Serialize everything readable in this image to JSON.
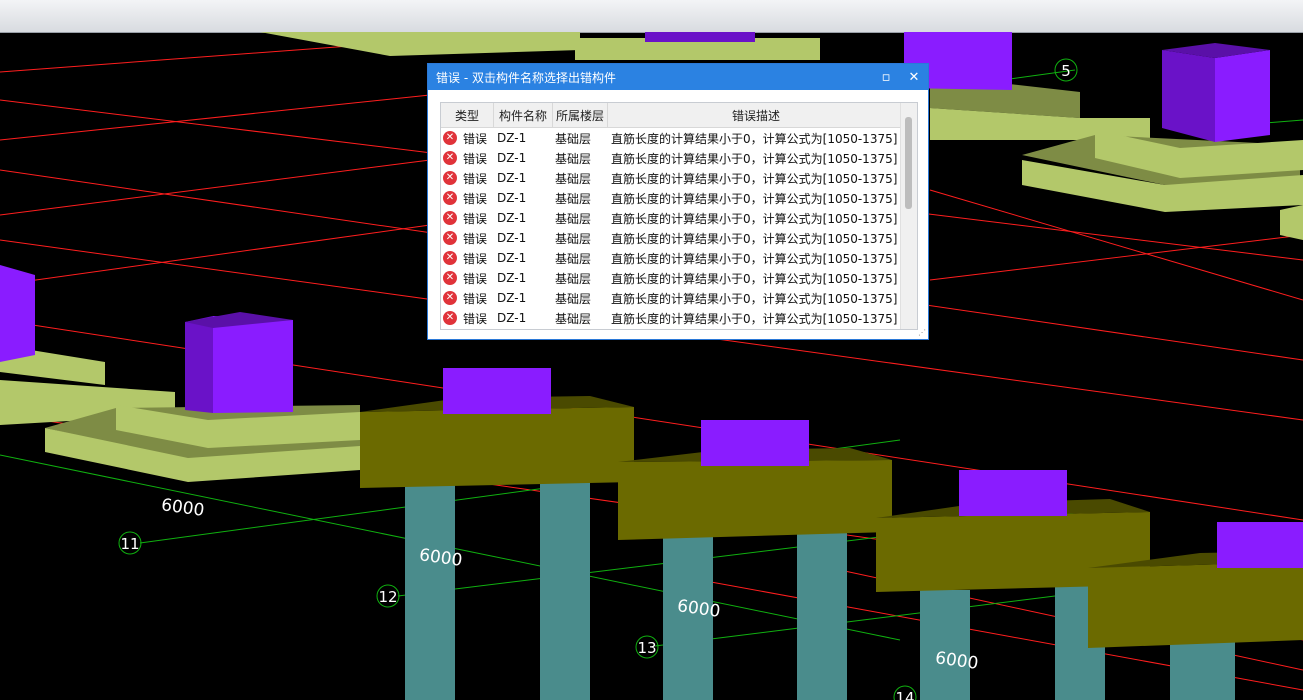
{
  "dialog": {
    "title": "错误 - 双击构件名称选择出错构件",
    "maximize_glyph": "▫",
    "close_glyph": "✕",
    "columns": [
      "类型",
      "构件名称",
      "所属楼层",
      "错误描述"
    ],
    "rows": [
      {
        "type": "错误",
        "name": "DZ-1",
        "floor": "基础层",
        "desc": "直筋长度的计算结果小于0，计算公式为[1050-1375]"
      },
      {
        "type": "错误",
        "name": "DZ-1",
        "floor": "基础层",
        "desc": "直筋长度的计算结果小于0，计算公式为[1050-1375]"
      },
      {
        "type": "错误",
        "name": "DZ-1",
        "floor": "基础层",
        "desc": "直筋长度的计算结果小于0，计算公式为[1050-1375]"
      },
      {
        "type": "错误",
        "name": "DZ-1",
        "floor": "基础层",
        "desc": "直筋长度的计算结果小于0，计算公式为[1050-1375]"
      },
      {
        "type": "错误",
        "name": "DZ-1",
        "floor": "基础层",
        "desc": "直筋长度的计算结果小于0，计算公式为[1050-1375]"
      },
      {
        "type": "错误",
        "name": "DZ-1",
        "floor": "基础层",
        "desc": "直筋长度的计算结果小于0，计算公式为[1050-1375]"
      },
      {
        "type": "错误",
        "name": "DZ-1",
        "floor": "基础层",
        "desc": "直筋长度的计算结果小于0，计算公式为[1050-1375]"
      },
      {
        "type": "错误",
        "name": "DZ-1",
        "floor": "基础层",
        "desc": "直筋长度的计算结果小于0，计算公式为[1050-1375]"
      },
      {
        "type": "错误",
        "name": "DZ-1",
        "floor": "基础层",
        "desc": "直筋长度的计算结果小于0，计算公式为[1050-1375]"
      },
      {
        "type": "错误",
        "name": "DZ-1",
        "floor": "基础层",
        "desc": "直筋长度的计算结果小于0，计算公式为[1050-1375]"
      }
    ]
  },
  "scene": {
    "axis_labels": [
      "5",
      "11",
      "12",
      "13",
      "14"
    ],
    "dimension_labels": [
      "6000",
      "6000",
      "6000",
      "6000"
    ],
    "colors": {
      "background": "#000000",
      "grid_red": "#ff1e1e",
      "grid_green": "#10b010",
      "footing_light": "#b3c86a",
      "footing_dark": "#7e8c45",
      "cap_top": "#5c5c00",
      "cap_front": "#6b6a00",
      "column_purple": "#8a1cff",
      "pile": "#4a8c8c"
    }
  }
}
